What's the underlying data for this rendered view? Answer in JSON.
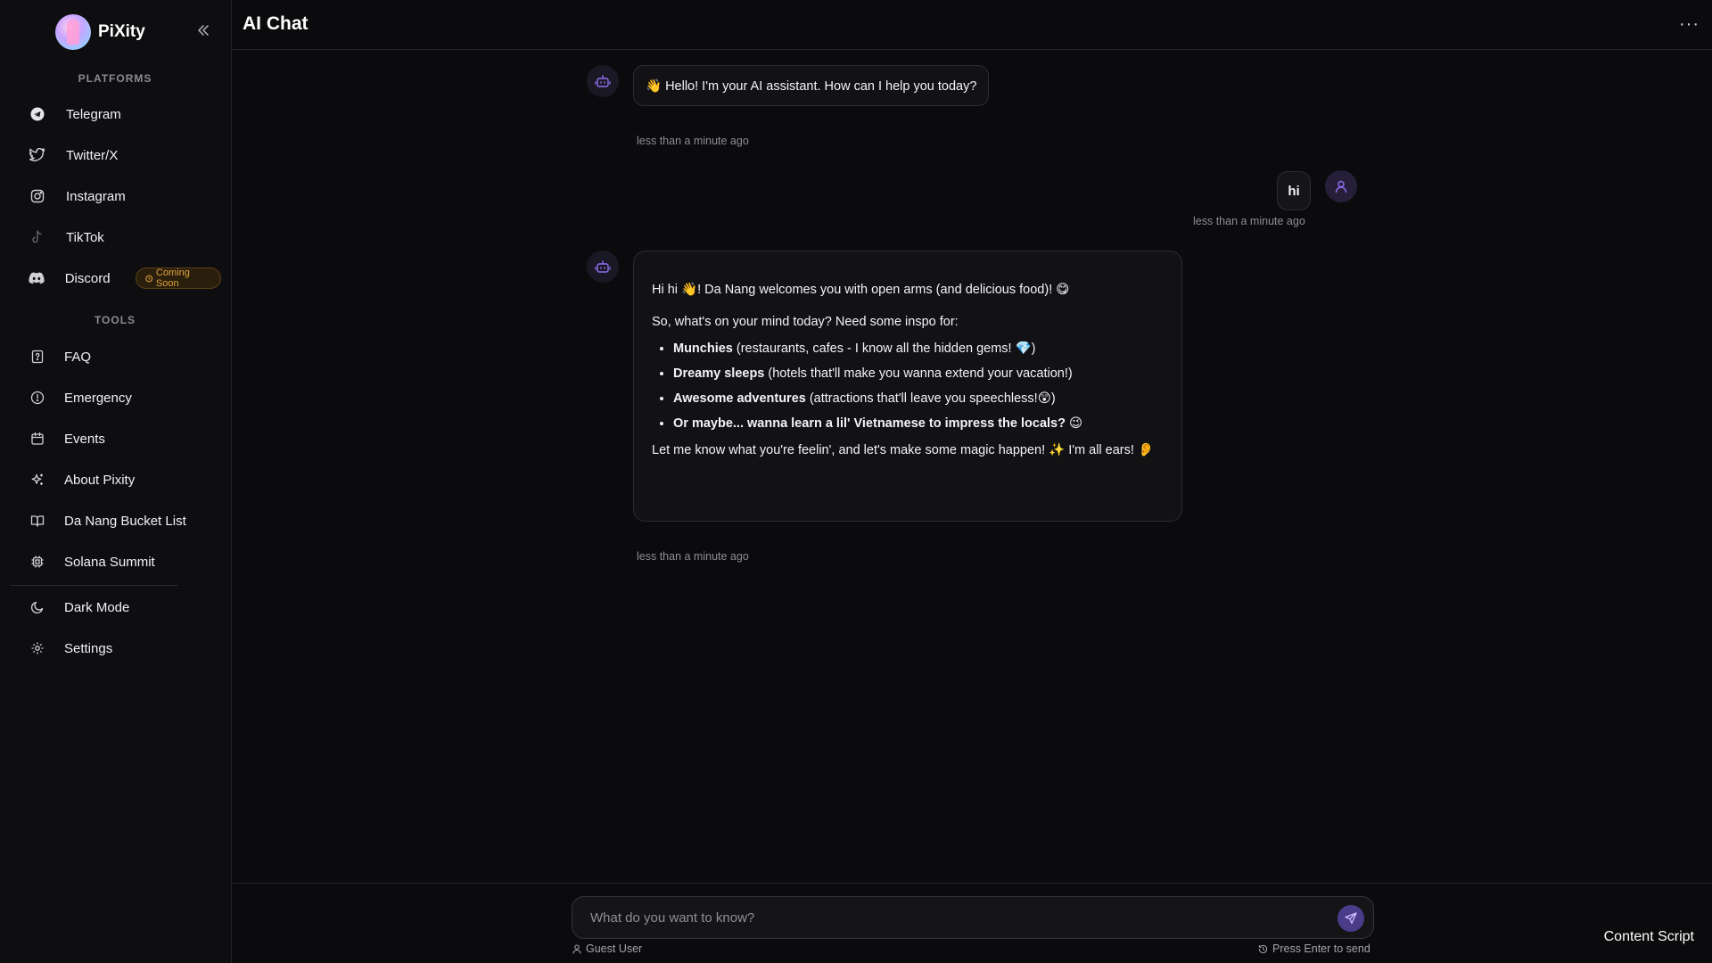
{
  "brand": {
    "name": "PiXity"
  },
  "sidebar": {
    "platforms_label": "PLATFORMS",
    "platforms": [
      {
        "label": "Telegram",
        "icon": "telegram-icon"
      },
      {
        "label": "Twitter/X",
        "icon": "twitter-icon"
      },
      {
        "label": "Instagram",
        "icon": "instagram-icon"
      },
      {
        "label": "TikTok",
        "icon": "tiktok-icon"
      },
      {
        "label": "Discord",
        "icon": "discord-icon",
        "badge": "Coming Soon"
      }
    ],
    "tools_label": "TOOLS",
    "tools": [
      {
        "label": "FAQ",
        "icon": "faq-icon"
      },
      {
        "label": "Emergency",
        "icon": "alert-circle-icon"
      },
      {
        "label": "Events",
        "icon": "calendar-icon"
      },
      {
        "label": "About Pixity",
        "icon": "sparkles-icon"
      },
      {
        "label": "Da Nang Bucket List",
        "icon": "book-icon"
      },
      {
        "label": "Solana Summit",
        "icon": "chip-icon"
      }
    ],
    "bottom": [
      {
        "label": "Dark Mode",
        "icon": "moon-icon"
      },
      {
        "label": "Settings",
        "icon": "gear-icon"
      }
    ]
  },
  "header": {
    "title": "AI Chat",
    "more": "···"
  },
  "messages": [
    {
      "role": "assistant",
      "text": "👋 Hello! I'm your AI assistant. How can I help you today?",
      "time": "less than a minute ago"
    },
    {
      "role": "user",
      "text": "hi",
      "time": "less than a minute ago"
    },
    {
      "role": "assistant",
      "intro": "Hi hi 👋! Da Nang welcomes you with open arms (and delicious food)! 😋",
      "question": "So, what's on your mind today? Need some inspo for:",
      "bullets": [
        {
          "bold": "Munchies",
          "rest": " (restaurants, cafes - I know all the hidden gems! 💎)"
        },
        {
          "bold": "Dreamy sleeps",
          "rest": " (hotels that'll make you wanna extend your vacation!)"
        },
        {
          "bold": "Awesome adventures",
          "rest": " (attractions that'll leave you speechless!😲)"
        },
        {
          "bold": "Or maybe... wanna learn a lil' Vietnamese to impress the locals?",
          "rest": " 😉"
        }
      ],
      "outro": "Let me know what you're feelin', and let's make some magic happen! ✨ I'm all ears! 👂",
      "time": "less than a minute ago"
    }
  ],
  "input": {
    "placeholder": "What do you want to know?",
    "value": "",
    "user_label": "Guest User",
    "hint": "Press Enter to send"
  },
  "corner_label": "Content Script",
  "colors": {
    "background": "#0b0b0d",
    "accent": "#4b3c8a",
    "badge": "#e0a23a"
  }
}
